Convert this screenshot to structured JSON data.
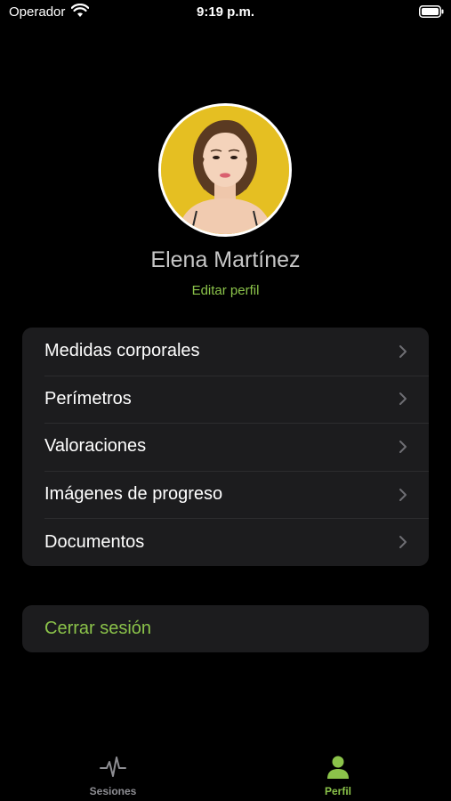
{
  "status_bar": {
    "carrier": "Operador",
    "time": "9:19 p.m."
  },
  "profile": {
    "name": "Elena Martínez",
    "edit_label": "Editar perfil"
  },
  "menu": {
    "items": [
      {
        "label": "Medidas corporales"
      },
      {
        "label": "Perímetros"
      },
      {
        "label": "Valoraciones"
      },
      {
        "label": "Imágenes de progreso"
      },
      {
        "label": "Documentos"
      }
    ]
  },
  "logout": {
    "label": "Cerrar sesión"
  },
  "tab_bar": {
    "tabs": [
      {
        "label": "Sesiones",
        "icon": "pulse-icon",
        "active": false
      },
      {
        "label": "Perfil",
        "icon": "person-icon",
        "active": true
      }
    ]
  },
  "colors": {
    "accent": "#8bc34a",
    "background": "#000000",
    "card": "#1c1c1e",
    "inactive": "#8e8e93"
  }
}
